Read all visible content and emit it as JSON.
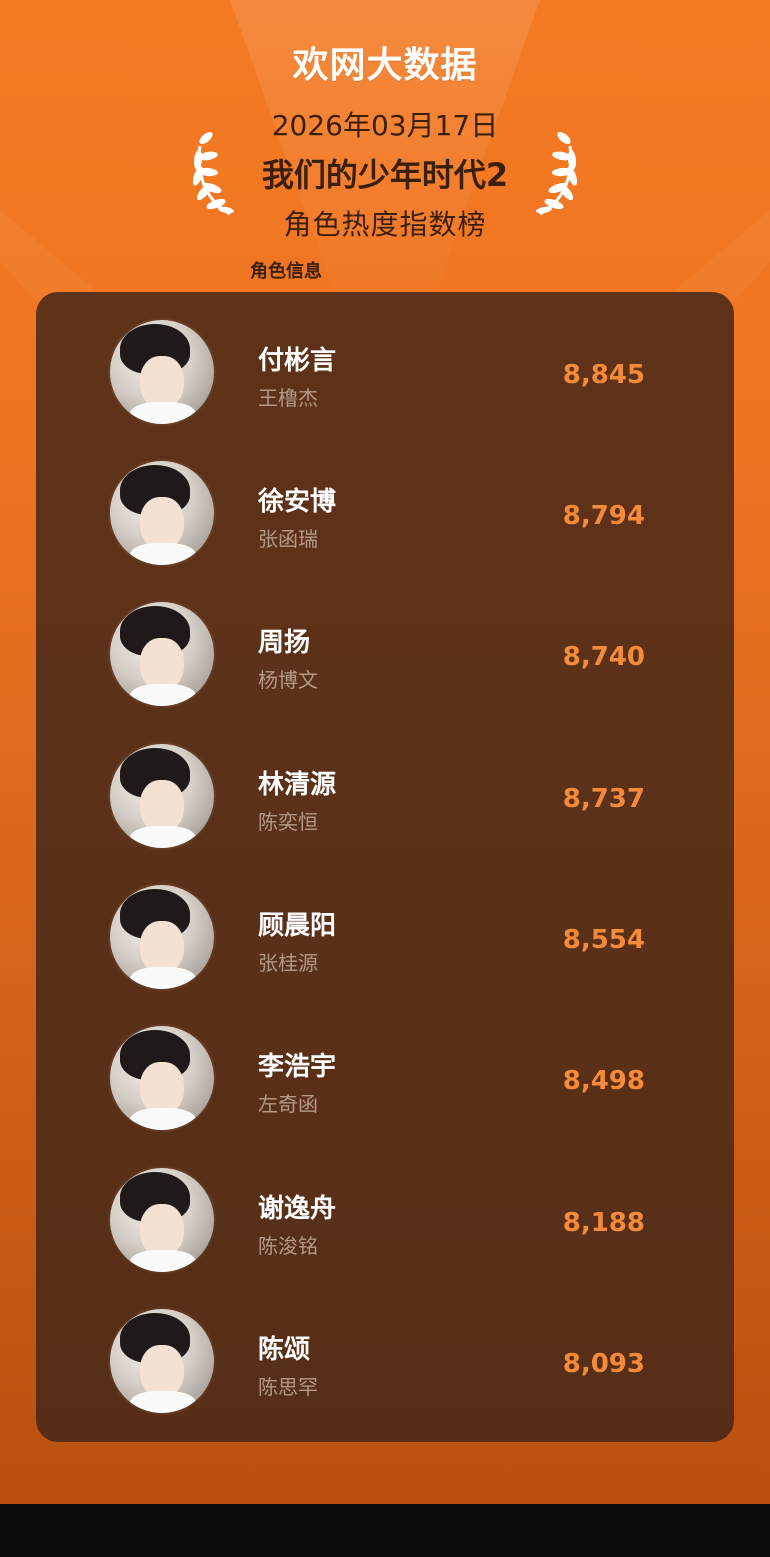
{
  "header": {
    "brand": "欢网大数据",
    "date": "2026年03月17日",
    "show_title": "我们的少年时代2",
    "subtitle": "角色热度指数榜",
    "col_role_info": "角色信息"
  },
  "colors": {
    "accent": "#f58a3a",
    "title_text": "#3b1f0d",
    "panel_bg": "#462819"
  },
  "rows": [
    {
      "role": "付彬言",
      "actor": "王橹杰",
      "score": "8,845",
      "icon": "avatar-photo"
    },
    {
      "role": "徐安博",
      "actor": "张函瑞",
      "score": "8,794",
      "icon": "avatar-photo"
    },
    {
      "role": "周扬",
      "actor": "杨博文",
      "score": "8,740",
      "icon": "avatar-photo"
    },
    {
      "role": "林清源",
      "actor": "陈奕恒",
      "score": "8,737",
      "icon": "avatar-photo"
    },
    {
      "role": "顾晨阳",
      "actor": "张桂源",
      "score": "8,554",
      "icon": "avatar-photo"
    },
    {
      "role": "李浩宇",
      "actor": "左奇函",
      "score": "8,498",
      "icon": "avatar-photo"
    },
    {
      "role": "谢逸舟",
      "actor": "陈浚铭",
      "score": "8,188",
      "icon": "avatar-photo"
    },
    {
      "role": "陈颂",
      "actor": "陈思罕",
      "score": "8,093",
      "icon": "avatar-photo"
    }
  ]
}
